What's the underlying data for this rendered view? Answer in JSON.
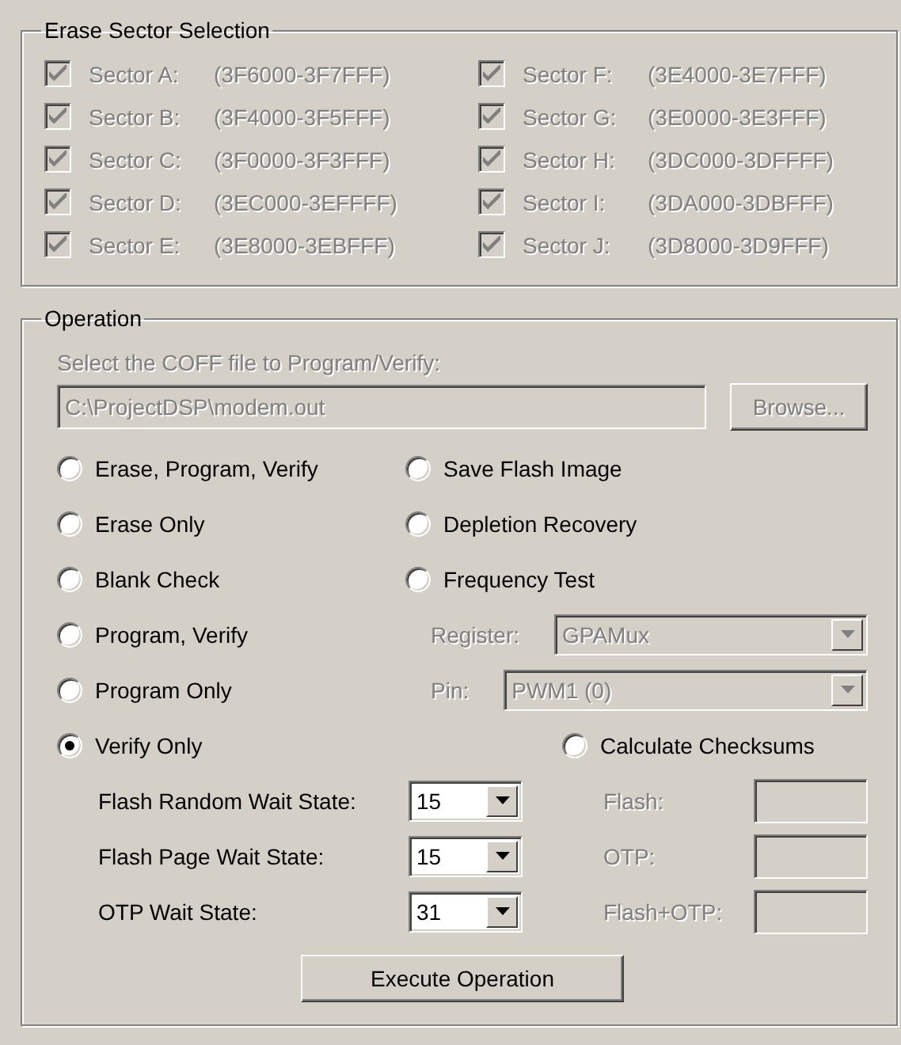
{
  "erase_sectors": {
    "title": "Erase Sector Selection",
    "disabled": true,
    "sectors": [
      {
        "label": "Sector A:",
        "range": "(3F6000-3F7FFF)",
        "checked": true
      },
      {
        "label": "Sector F:",
        "range": "(3E4000-3E7FFF)",
        "checked": true
      },
      {
        "label": "Sector B:",
        "range": "(3F4000-3F5FFF)",
        "checked": true
      },
      {
        "label": "Sector G:",
        "range": "(3E0000-3E3FFF)",
        "checked": true
      },
      {
        "label": "Sector C:",
        "range": "(3F0000-3F3FFF)",
        "checked": true
      },
      {
        "label": "Sector H:",
        "range": "(3DC000-3DFFFF)",
        "checked": true
      },
      {
        "label": "Sector D:",
        "range": "(3EC000-3EFFFF)",
        "checked": true
      },
      {
        "label": "Sector I:",
        "range": "(3DA000-3DBFFF)",
        "checked": true
      },
      {
        "label": "Sector E:",
        "range": "(3E8000-3EBFFF)",
        "checked": true
      },
      {
        "label": "Sector J:",
        "range": "(3D8000-3D9FFF)",
        "checked": true
      }
    ]
  },
  "operation": {
    "title": "Operation",
    "file": {
      "label": "Select the COFF file to Program/Verify:",
      "value": "C:\\ProjectDSP\\modem.out",
      "browse_button": "Browse...",
      "disabled": true
    },
    "options_left": [
      {
        "label": "Erase, Program, Verify",
        "selected": false
      },
      {
        "label": "Erase Only",
        "selected": false
      },
      {
        "label": "Blank Check",
        "selected": false
      },
      {
        "label": "Program, Verify",
        "selected": false
      },
      {
        "label": "Program Only",
        "selected": false
      },
      {
        "label": "Verify Only",
        "selected": true
      }
    ],
    "options_right": [
      {
        "label": "Save Flash Image",
        "selected": false
      },
      {
        "label": "Depletion Recovery",
        "selected": false
      },
      {
        "label": "Frequency Test",
        "selected": false
      }
    ],
    "frequency_settings": {
      "disabled": true,
      "fields": [
        {
          "label": "Register:",
          "value": "GPAMux"
        },
        {
          "label": "Pin:",
          "value": "PWM1 (0)"
        }
      ]
    },
    "checksum_option": {
      "label": "Calculate Checksums",
      "selected": false
    },
    "checksum_fields": {
      "disabled": true,
      "fields": [
        {
          "label": "Flash:"
        },
        {
          "label": "OTP:"
        },
        {
          "label": "Flash+OTP:"
        }
      ]
    },
    "wait_states": [
      {
        "label": "Flash Random Wait State:",
        "value": "15"
      },
      {
        "label": "Flash Page Wait State:",
        "value": "15"
      },
      {
        "label": "OTP Wait State:",
        "value": "31"
      }
    ],
    "execute_button": "Execute Operation"
  }
}
